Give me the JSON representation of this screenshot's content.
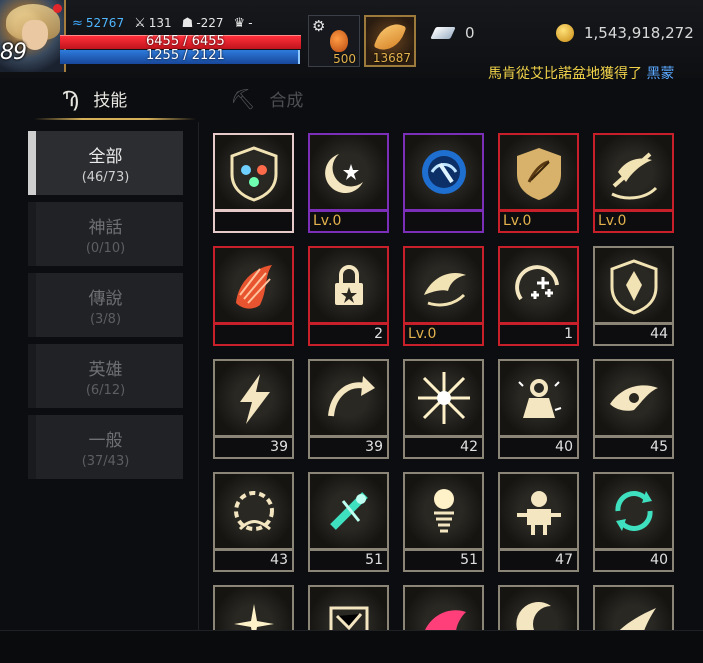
{
  "hud": {
    "level": "89",
    "stats": [
      {
        "icon": "swirl-icon",
        "value": "52767"
      },
      {
        "icon": "crossed-swords-icon",
        "value": "131"
      },
      {
        "icon": "helmet-icon",
        "value": "-227"
      },
      {
        "icon": "trophy-icon",
        "value": "-"
      }
    ],
    "hp": "6455 / 6455",
    "mp": "1255 / 2121",
    "potion_count": "500",
    "feather_count": "13687",
    "gems": "0",
    "gold": "1,543,918,272",
    "ticker_text": "馬肯從艾比諾盆地獲得了",
    "ticker_highlight": "黑蒙"
  },
  "tabs": {
    "skills": "技能",
    "combine": "合成"
  },
  "categories": [
    {
      "name": "全部",
      "count": "(46/73)",
      "active": true
    },
    {
      "name": "神話",
      "count": "(0/10)",
      "active": false
    },
    {
      "name": "傳說",
      "count": "(3/8)",
      "active": false
    },
    {
      "name": "英雄",
      "count": "(6/12)",
      "active": false
    },
    {
      "name": "一般",
      "count": "(37/43)",
      "active": false
    }
  ],
  "skills": [
    {
      "icon": "shield-elements-icon",
      "border": "white",
      "lv": "",
      "num": ""
    },
    {
      "icon": "moon-star-icon",
      "border": "purple",
      "lv": "Lv.0",
      "num": ""
    },
    {
      "icon": "blue-orb-icon",
      "border": "purple",
      "lv": "",
      "num": ""
    },
    {
      "icon": "archer-shield-icon",
      "border": "red",
      "lv": "Lv.0",
      "num": ""
    },
    {
      "icon": "winged-sword-icon",
      "border": "red",
      "lv": "Lv.0",
      "num": ""
    },
    {
      "icon": "fire-claw-icon",
      "border": "red",
      "lv": "",
      "num": ""
    },
    {
      "icon": "star-lock-icon",
      "border": "red",
      "lv": "",
      "num": "2"
    },
    {
      "icon": "dragon-icon",
      "border": "red",
      "lv": "Lv.0",
      "num": ""
    },
    {
      "icon": "plus-arc-icon",
      "border": "red",
      "lv": "",
      "num": "1"
    },
    {
      "icon": "shield-crystal-icon",
      "border": "gray",
      "lv": "",
      "num": "44"
    },
    {
      "icon": "lightning-icon",
      "border": "gray",
      "lv": "",
      "num": "39"
    },
    {
      "icon": "curved-arrow-icon",
      "border": "gray",
      "lv": "",
      "num": "39"
    },
    {
      "icon": "burst-icon",
      "border": "gray",
      "lv": "",
      "num": "42"
    },
    {
      "icon": "heavy-weight-icon",
      "border": "gray",
      "lv": "",
      "num": "40"
    },
    {
      "icon": "eagle-eye-icon",
      "border": "gray",
      "lv": "",
      "num": "45"
    },
    {
      "icon": "thorn-ring-icon",
      "border": "gray",
      "lv": "",
      "num": "43"
    },
    {
      "icon": "teal-slash-icon",
      "border": "gray",
      "lv": "",
      "num": "51"
    },
    {
      "icon": "spring-orb-icon",
      "border": "gray",
      "lv": "",
      "num": "51"
    },
    {
      "icon": "armored-knight-icon",
      "border": "gray",
      "lv": "",
      "num": "47"
    },
    {
      "icon": "teal-cycle-icon",
      "border": "gray",
      "lv": "",
      "num": "40"
    },
    {
      "icon": "sparkle-icon",
      "border": "gray",
      "lv": "",
      "num": ""
    },
    {
      "icon": "rune-icon",
      "border": "gray",
      "lv": "",
      "num": ""
    },
    {
      "icon": "pink-wing-icon",
      "border": "gray",
      "lv": "",
      "num": ""
    },
    {
      "icon": "crescent-icon",
      "border": "gray",
      "lv": "",
      "num": ""
    },
    {
      "icon": "flame-dash-icon",
      "border": "gray",
      "lv": "",
      "num": ""
    }
  ]
}
